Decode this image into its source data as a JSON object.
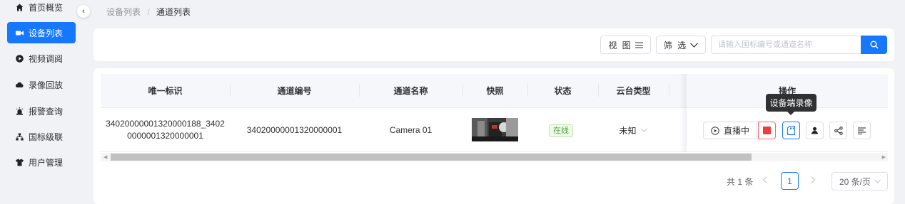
{
  "sidebar": {
    "items": [
      {
        "label": "首页概览",
        "icon": "home-icon"
      },
      {
        "label": "设备列表",
        "icon": "video-camera-icon",
        "active": true
      },
      {
        "label": "视频调阅",
        "icon": "play-circle-icon"
      },
      {
        "label": "录像回放",
        "icon": "cloud-icon"
      },
      {
        "label": "报警查询",
        "icon": "alarm-icon"
      },
      {
        "label": "国标级联",
        "icon": "cascade-icon"
      },
      {
        "label": "用户管理",
        "icon": "user-shirt-icon"
      }
    ],
    "collapse_glyph": "‹"
  },
  "breadcrumb": {
    "parent": "设备列表",
    "separator": "/",
    "current": "通道列表"
  },
  "toolbar": {
    "view_label": "视 图",
    "filter_label": "筛 选",
    "search_placeholder": "请输入国标编号或通道名称"
  },
  "table": {
    "columns": [
      "唯一标识",
      "通道编号",
      "通道名称",
      "快照",
      "状态",
      "云台类型",
      "操作"
    ],
    "rows": [
      {
        "unique_id": "34020000001320000188_34020000001320000001",
        "channel_id": "34020000001320000001",
        "channel_name": "Camera 01",
        "status": "在线",
        "ptz_type": "未知",
        "live_label": "直播中"
      }
    ]
  },
  "tooltip": "设备端录像",
  "pagination": {
    "total_text": "共 1 条",
    "current_page": "1",
    "page_size": "20 条/页"
  },
  "colors": {
    "primary": "#1677ff",
    "danger": "#f56c6c",
    "success": "#52a438"
  }
}
